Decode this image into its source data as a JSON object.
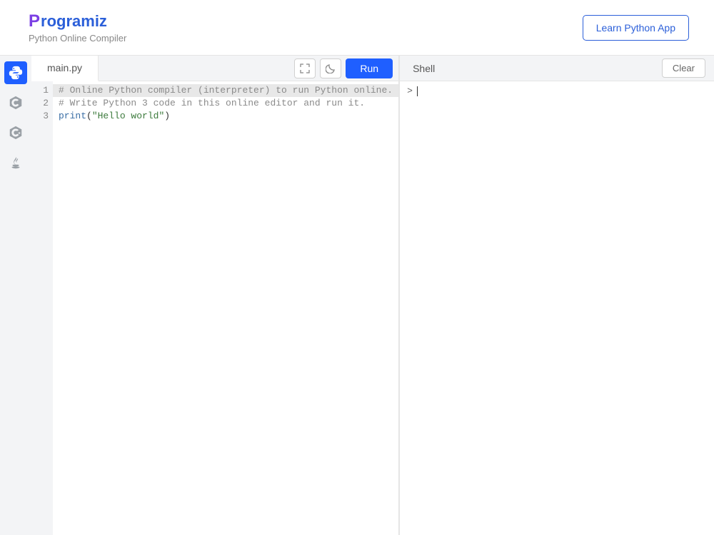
{
  "header": {
    "brand_name": "rogramiz",
    "subtitle": "Python Online Compiler",
    "learn_button": "Learn Python App"
  },
  "sidebar": {
    "languages": [
      {
        "id": "python",
        "name": "Python",
        "active": true
      },
      {
        "id": "c",
        "name": "C",
        "active": false
      },
      {
        "id": "cpp",
        "name": "C++",
        "active": false
      },
      {
        "id": "java",
        "name": "Java",
        "active": false
      }
    ]
  },
  "editor": {
    "tab_name": "main.py",
    "run_button": "Run",
    "lines": {
      "1": "# Online Python compiler (interpreter) to run Python online.",
      "2": "# Write Python 3 code in this online editor and run it.",
      "3_func": "print",
      "3_open": "(",
      "3_str": "\"Hello world\"",
      "3_close": ")"
    }
  },
  "shell": {
    "label": "Shell",
    "clear_button": "Clear",
    "prompt": ">"
  }
}
